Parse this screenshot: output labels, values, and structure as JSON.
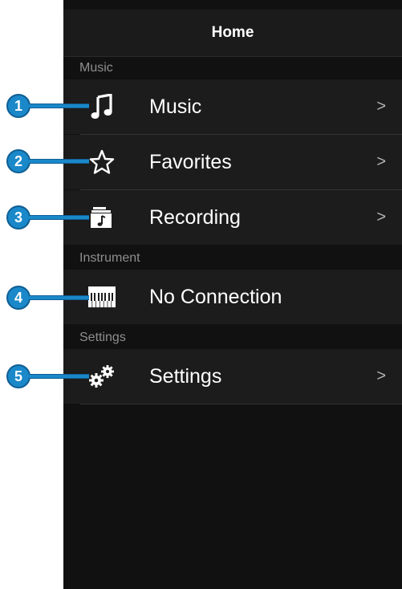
{
  "navbar": {
    "title": "Home"
  },
  "sections": {
    "music": {
      "header": "Music"
    },
    "instrument": {
      "header": "Instrument"
    },
    "settings": {
      "header": "Settings"
    }
  },
  "rows": {
    "music": {
      "label": "Music",
      "icon": "music-note-icon",
      "chevron": ">"
    },
    "favorites": {
      "label": "Favorites",
      "icon": "star-icon",
      "chevron": ">"
    },
    "recording": {
      "label": "Recording",
      "icon": "recording-folder-icon",
      "chevron": ">"
    },
    "instrument": {
      "label": "No Connection",
      "icon": "piano-keyboard-icon"
    },
    "settings": {
      "label": "Settings",
      "icon": "gears-icon",
      "chevron": ">"
    }
  },
  "callouts": [
    "1",
    "2",
    "3",
    "4",
    "5"
  ],
  "colors": {
    "callout_blue": "#1a88c9",
    "background": "#111111",
    "row_background": "#1c1c1c",
    "section_text": "#8e8e8e"
  }
}
